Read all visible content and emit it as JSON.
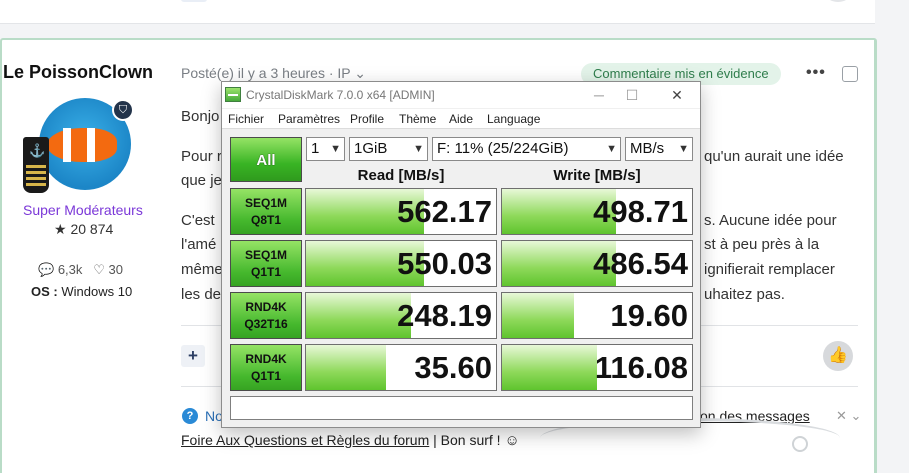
{
  "post": {
    "author": "Le PoissonClown",
    "role": "Super Modérateurs",
    "reputation": "20 874",
    "stats": {
      "comments": "6,3k",
      "likes": "30"
    },
    "os_label": "OS :",
    "os_value": "Windows 10",
    "meta": "Posté(e) il y a 3 heures · IP",
    "featured_label": "Commentaire mis en évidence",
    "more_icon": "•••",
    "body_lines": [
      "Bonjo",
      "Pour r",
      "que je",
      "C'est",
      "l'amé",
      "même",
      "les de"
    ],
    "body_right": [
      "qu'un aurait une idée",
      "s. Aucune idée pour",
      "st à peu près à la",
      "ignifierait remplacer",
      "uhaitez pas."
    ],
    "plus_label": "+",
    "help_text": "No",
    "messages_link": "on des messages",
    "footer_link": "Foire Aux Questions et Règles du forum",
    "footer_rest": " | Bon surf ! ",
    "footer_smile": "☺"
  },
  "cdm": {
    "title": "CrystalDiskMark 7.0.0 x64 [ADMIN]",
    "menu": [
      "Fichier",
      "Paramètres",
      "Profile",
      "Thème",
      "Aide",
      "Language"
    ],
    "all_label": "All",
    "count_select": "1",
    "size_select": "1GiB",
    "drive_select": "F: 11% (25/224GiB)",
    "unit_select": "MB/s",
    "read_header": "Read [MB/s]",
    "write_header": "Write [MB/s]",
    "rows": [
      {
        "line1": "SEQ1M",
        "line2": "Q8T1",
        "read": "562.17",
        "write": "498.71",
        "read_fill": 0.62,
        "write_fill": 0.6
      },
      {
        "line1": "SEQ1M",
        "line2": "Q1T1",
        "read": "550.03",
        "write": "486.54",
        "read_fill": 0.62,
        "write_fill": 0.6
      },
      {
        "line1": "RND4K",
        "line2": "Q32T16",
        "read": "248.19",
        "write": "19.60",
        "read_fill": 0.55,
        "write_fill": 0.38
      },
      {
        "line1": "RND4K",
        "line2": "Q1T1",
        "read": "35.60",
        "write": "116.08",
        "read_fill": 0.42,
        "write_fill": 0.5
      }
    ],
    "comment": ""
  }
}
